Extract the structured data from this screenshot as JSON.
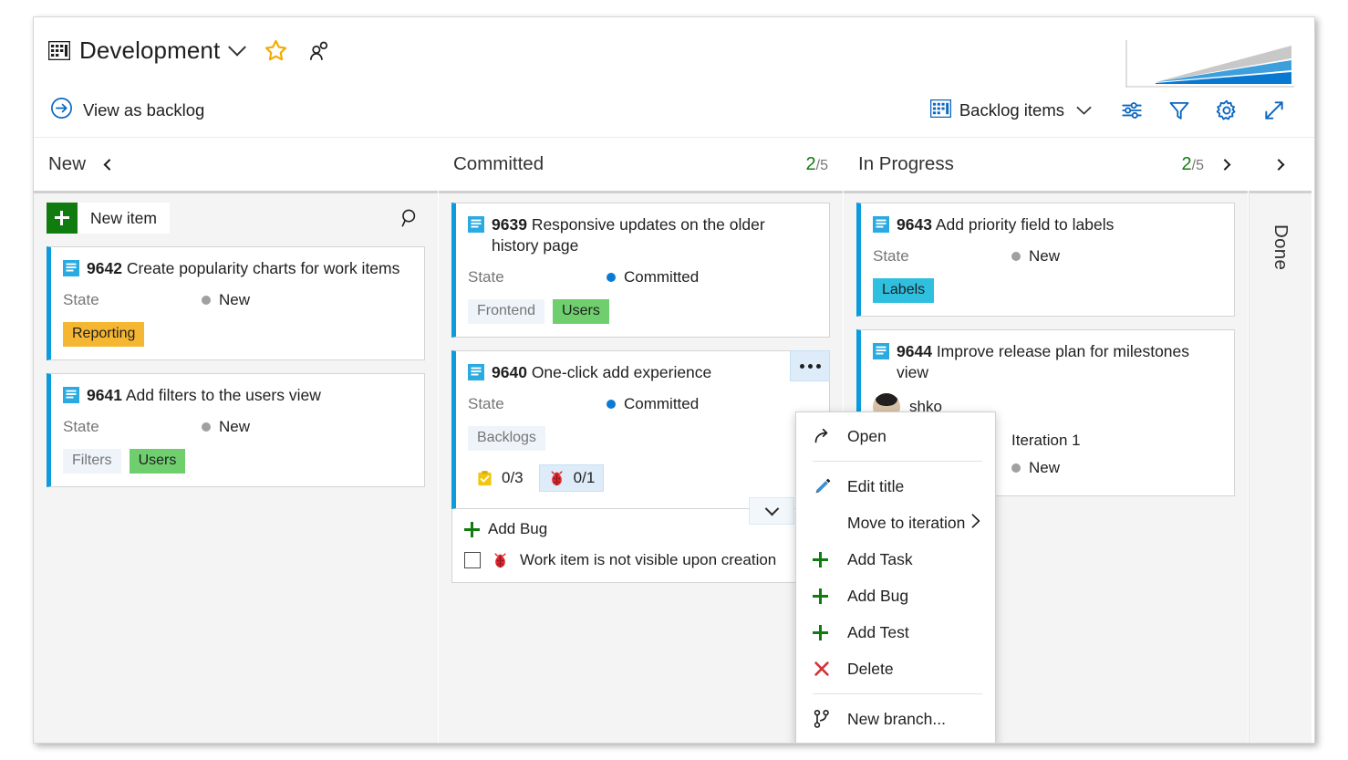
{
  "header": {
    "board_icon": "board-grid-icon",
    "title": "Development",
    "title_chevron": "chevron-down-icon",
    "favorite_icon": "star-icon",
    "team_icon": "people-icon",
    "cfd_chart": "cumulative-flow-thumbnail"
  },
  "commandbar": {
    "backlog_icon": "arrow-right-circle-icon",
    "backlog_label": "View as backlog",
    "level_icon": "board-grid-icon",
    "level_label": "Backlog items",
    "level_chevron": "chevron-down-icon",
    "settings_sliders_icon": "sliders-icon",
    "filter_icon": "funnel-icon",
    "gear_icon": "gear-icon",
    "fullscreen_icon": "expand-diagonal-icon"
  },
  "board": {
    "columns": [
      {
        "name": "New",
        "count": "",
        "limit": "",
        "collapse_icon": "chevron-left-icon",
        "new_item_label": "New item",
        "search_icon": "search-icon"
      },
      {
        "name": "Committed",
        "count": "2",
        "limit": "/5"
      },
      {
        "name": "In Progress",
        "count": "2",
        "limit": "/5",
        "collapse_icon": "chevron-right-icon"
      },
      {
        "name": "Done"
      }
    ],
    "cards": {
      "c9642": {
        "id": "9642",
        "title": "Create popularity charts for work items",
        "state_label": "State",
        "state_value": "New",
        "state_color": "#a0a0a0",
        "tags": [
          {
            "text": "Reporting",
            "bg": "#f5b731",
            "fg": "#1f1f1f"
          }
        ]
      },
      "c9641": {
        "id": "9641",
        "title": "Add filters to the users view",
        "state_label": "State",
        "state_value": "New",
        "state_color": "#a0a0a0",
        "tags": [
          {
            "text": "Filters",
            "bg": "#eef4fa",
            "fg": "#767676"
          },
          {
            "text": "Users",
            "bg": "#6fcf6f",
            "fg": "#1f1f1f"
          }
        ]
      },
      "c9639": {
        "id": "9639",
        "title": "Responsive updates on the older history page",
        "state_label": "State",
        "state_value": "Committed",
        "state_color": "#0a7bd4",
        "tags": [
          {
            "text": "Frontend",
            "bg": "#eef4fa",
            "fg": "#767676"
          },
          {
            "text": "Users",
            "bg": "#6fcf6f",
            "fg": "#1f1f1f"
          }
        ]
      },
      "c9640": {
        "id": "9640",
        "title": "One-click add experience",
        "state_label": "State",
        "state_value": "Committed",
        "state_color": "#0a7bd4",
        "tags": [
          {
            "text": "Backlogs",
            "bg": "#eef4fa",
            "fg": "#767676"
          }
        ],
        "badges": [
          {
            "icon": "task-checklist-icon",
            "text": "0/3",
            "selected": false
          },
          {
            "icon": "bug-icon",
            "text": "0/1",
            "selected": true
          }
        ],
        "expander_icon": "chevron-down-icon",
        "overflow_icon": "ellipsis-icon",
        "addpanel": {
          "add_icon": "plus-icon",
          "add_label": "Add Bug",
          "checkbox_icon": "checkbox-unchecked-icon",
          "notice_icon": "bug-icon",
          "notice_text": "Work item is not visible upon creation"
        }
      },
      "c9643": {
        "id": "9643",
        "title": "Add priority field to labels",
        "state_label": "State",
        "state_value": "New",
        "state_color": "#a0a0a0",
        "tags": [
          {
            "text": "Labels",
            "bg": "#2fc0e0",
            "fg": "#1f1f1f"
          }
        ]
      },
      "c9644": {
        "id": "9644",
        "title": "Improve release plan for milestones view",
        "assignee_avatar": "avatar",
        "assignee_name": "shko",
        "iteration": "Iteration 1",
        "state_value": "New",
        "state_color": "#a0a0a0"
      }
    }
  },
  "context_menu": {
    "items": [
      {
        "label": "Open",
        "icon": "open-arrow-icon"
      },
      {
        "separator": true
      },
      {
        "label": "Edit title",
        "icon": "pencil-icon"
      },
      {
        "label": "Move to iteration",
        "icon": "",
        "submenu_icon": "chevron-right-icon"
      },
      {
        "label": "Add Task",
        "icon": "plus-icon"
      },
      {
        "label": "Add Bug",
        "icon": "plus-icon"
      },
      {
        "label": "Add Test",
        "icon": "plus-icon"
      },
      {
        "label": "Delete",
        "icon": "x-delete-icon"
      },
      {
        "separator": true
      },
      {
        "label": "New branch...",
        "icon": "branch-icon"
      }
    ]
  },
  "colors": {
    "accent_blue": "#0a67c2",
    "card_stripe": "#0d9cdb",
    "green": "#107c10",
    "red": "#d13438",
    "star_gold": "#f2ab00"
  }
}
